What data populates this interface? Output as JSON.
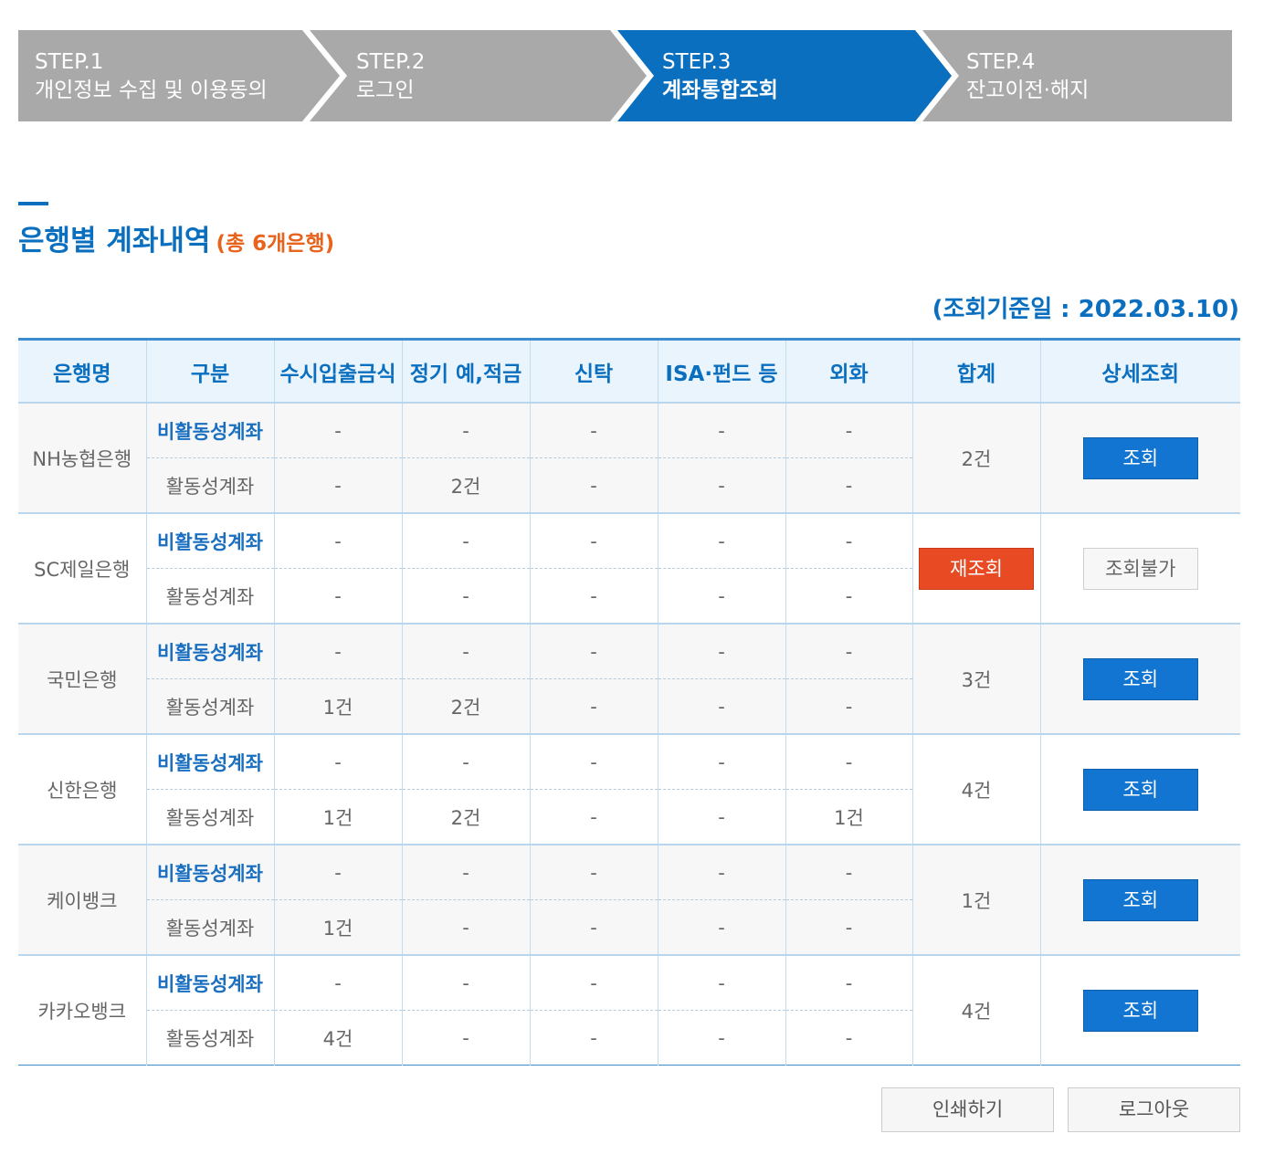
{
  "steps": [
    {
      "num": "STEP.1",
      "name": "개인정보 수집 및 이용동의",
      "active": false
    },
    {
      "num": "STEP.2",
      "name": "로그인",
      "active": false
    },
    {
      "num": "STEP.3",
      "name": "계좌통합조회",
      "active": true
    },
    {
      "num": "STEP.4",
      "name": "잔고이전·해지",
      "active": false
    }
  ],
  "colors": {
    "step_inactive": "#a9a9a9",
    "step_active": "#0b6fbf",
    "accent": "#0b6fbf",
    "count_orange": "#e8641c",
    "retry_red": "#e84a24"
  },
  "title": "은행별 계좌내역",
  "title_count": "(총 6개은행)",
  "ref_date": "(조회기준일 : 2022.03.10)",
  "table": {
    "headers": [
      "은행명",
      "구분",
      "수시입출금식",
      "정기 예,적금",
      "신탁",
      "ISA·펀드 등",
      "외화",
      "합계",
      "상세조회"
    ],
    "rows": [
      {
        "bank": "NH농협은행",
        "inactive_label": "비활동성계좌",
        "active_label": "활동성계좌",
        "inactive": [
          "-",
          "-",
          "-",
          "-",
          "-"
        ],
        "active": [
          "-",
          "2건",
          "-",
          "-",
          "-"
        ],
        "total": "2건",
        "action": "조회"
      },
      {
        "bank": "SC제일은행",
        "inactive_label": "비활동성계좌",
        "active_label": "활동성계좌",
        "inactive": [
          "-",
          "-",
          "-",
          "-",
          "-"
        ],
        "active": [
          "-",
          "-",
          "-",
          "-",
          "-"
        ],
        "total": "재조회",
        "action": "조회불가"
      },
      {
        "bank": "국민은행",
        "inactive_label": "비활동성계좌",
        "active_label": "활동성계좌",
        "inactive": [
          "-",
          "-",
          "-",
          "-",
          "-"
        ],
        "active": [
          "1건",
          "2건",
          "-",
          "-",
          "-"
        ],
        "total": "3건",
        "action": "조회"
      },
      {
        "bank": "신한은행",
        "inactive_label": "비활동성계좌",
        "active_label": "활동성계좌",
        "inactive": [
          "-",
          "-",
          "-",
          "-",
          "-"
        ],
        "active": [
          "1건",
          "2건",
          "-",
          "-",
          "1건"
        ],
        "total": "4건",
        "action": "조회"
      },
      {
        "bank": "케이뱅크",
        "inactive_label": "비활동성계좌",
        "active_label": "활동성계좌",
        "inactive": [
          "-",
          "-",
          "-",
          "-",
          "-"
        ],
        "active": [
          "1건",
          "-",
          "-",
          "-",
          "-"
        ],
        "total": "1건",
        "action": "조회"
      },
      {
        "bank": "카카오뱅크",
        "inactive_label": "비활동성계좌",
        "active_label": "활동성계좌",
        "inactive": [
          "-",
          "-",
          "-",
          "-",
          "-"
        ],
        "active": [
          "4건",
          "-",
          "-",
          "-",
          "-"
        ],
        "total": "4건",
        "action": "조회"
      }
    ]
  },
  "buttons": {
    "print": "인쇄하기",
    "logout": "로그아웃"
  }
}
